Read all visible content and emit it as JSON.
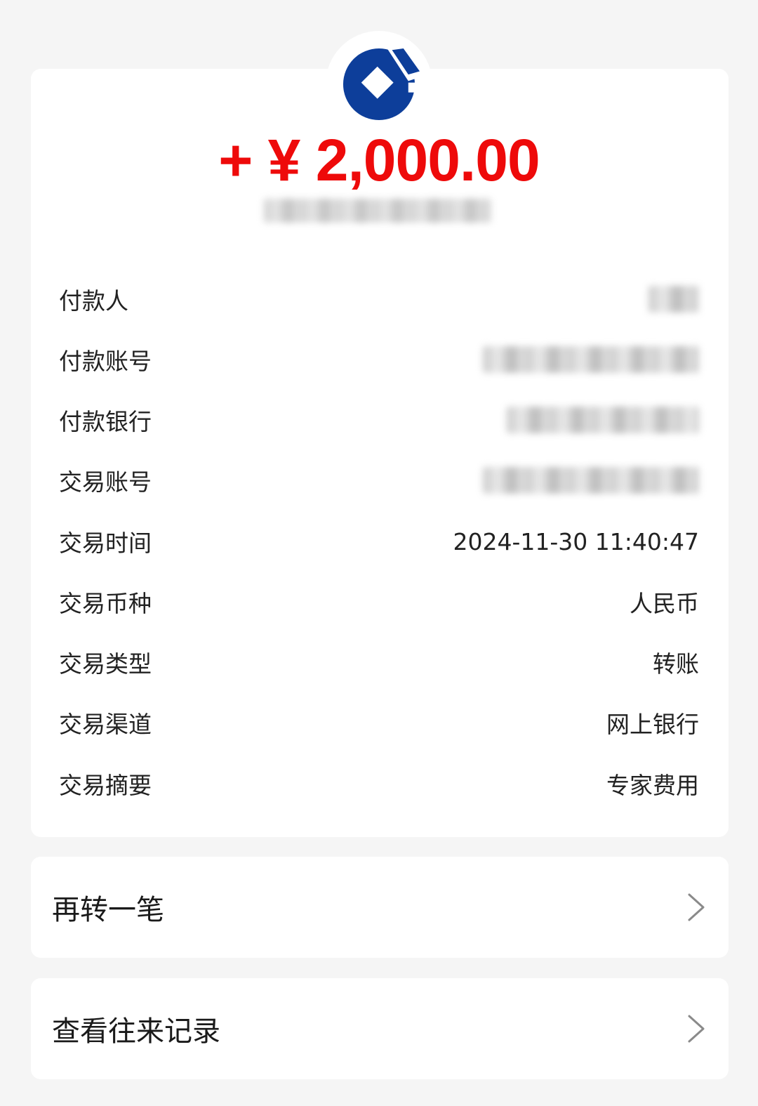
{
  "amount": "+ ¥ 2,000.00",
  "details": [
    {
      "label": "付款人",
      "value": ""
    },
    {
      "label": "付款账号",
      "value": ""
    },
    {
      "label": "付款银行",
      "value": ""
    },
    {
      "label": "交易账号",
      "value": ""
    },
    {
      "label": "交易时间",
      "value": "2024-11-30 11:40:47"
    },
    {
      "label": "交易币种",
      "value": "人民币"
    },
    {
      "label": "交易类型",
      "value": "转账"
    },
    {
      "label": "交易渠道",
      "value": "网上银行"
    },
    {
      "label": "交易摘要",
      "value": "专家费用"
    }
  ],
  "actions": {
    "transfer_again": "再转一笔",
    "view_history": "查看往来记录"
  },
  "colors": {
    "amount": "#ee0a0a",
    "brand_blue": "#0d3e9a",
    "background": "#f5f5f5",
    "card": "#ffffff"
  },
  "icons": {
    "logo": "bank-logo-icon",
    "chevron": "chevron-right-icon"
  }
}
